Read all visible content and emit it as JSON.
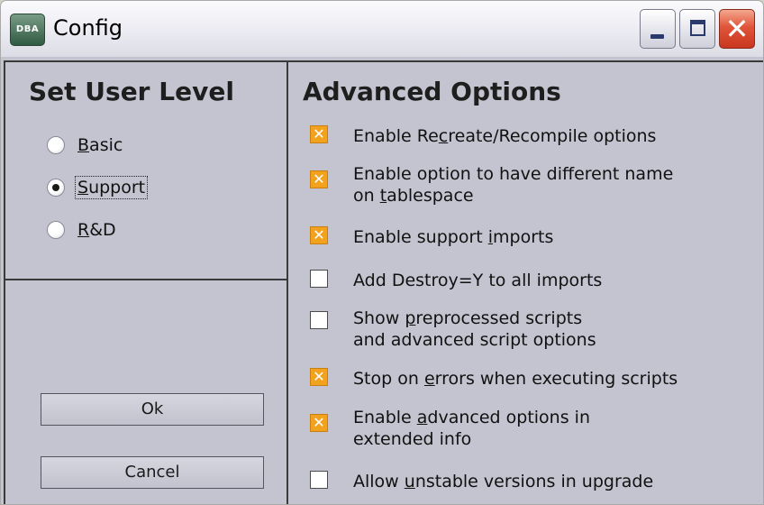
{
  "window": {
    "title": "Config",
    "icon_label": "DBA",
    "minimize_icon": "minimize-icon",
    "maximize_icon": "maximize-icon",
    "close_icon": "close-icon"
  },
  "user_level": {
    "heading": "Set User Level",
    "options": [
      {
        "prefix": "",
        "key": "B",
        "rest": "asic",
        "checked": false
      },
      {
        "prefix": "",
        "key": "S",
        "rest": "upport",
        "checked": true
      },
      {
        "prefix": "",
        "key": "R",
        "rest": "&D",
        "checked": false
      }
    ]
  },
  "buttons": {
    "ok": "Ok",
    "cancel": "Cancel"
  },
  "advanced": {
    "heading": "Advanced Options",
    "options": [
      {
        "pre": "Enable Re",
        "key": "c",
        "post": "reate/Recompile options",
        "checked": true
      },
      {
        "pre": "Enable option to have different name\non ",
        "key": "t",
        "post": "ablespace",
        "checked": true
      },
      {
        "pre": "Enable support ",
        "key": "i",
        "post": "mports",
        "checked": true
      },
      {
        "pre": "Add Destroy=Y to all imports",
        "key": "",
        "post": "",
        "checked": false
      },
      {
        "pre": "Show ",
        "key": "p",
        "post": "reprocessed scripts\nand advanced script options",
        "checked": false
      },
      {
        "pre": "Stop on ",
        "key": "e",
        "post": "rrors when executing scripts",
        "checked": true
      },
      {
        "pre": "Enable ",
        "key": "a",
        "post": "dvanced options in\nextended info",
        "checked": true
      },
      {
        "pre": "Allow ",
        "key": "u",
        "post": "nstable versions in upgrade",
        "checked": false
      }
    ]
  },
  "colors": {
    "checked_box": "#f3a21d",
    "background": "#c4c4d0",
    "close_button": "#e0553a"
  }
}
